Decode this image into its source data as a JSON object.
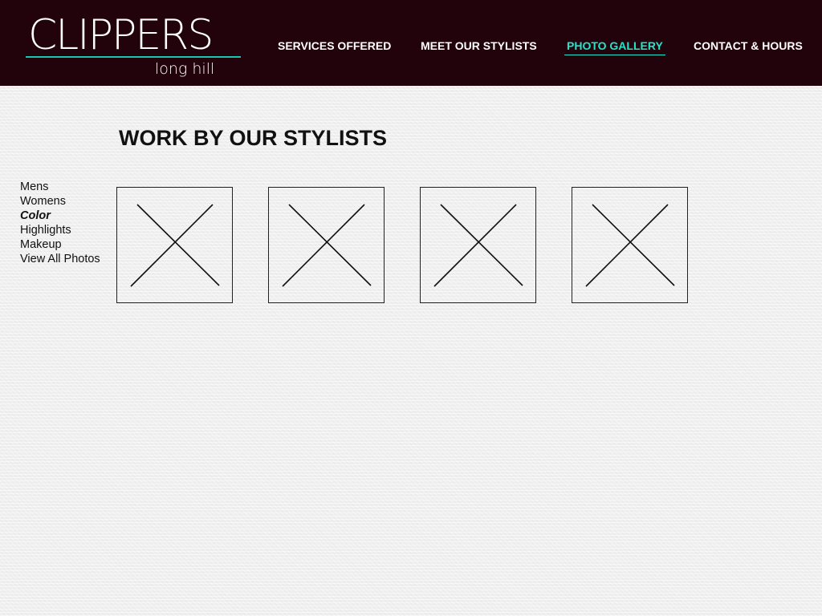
{
  "brand": {
    "name": "CLIPPERS",
    "location": "long hill",
    "accent_color": "#24e4cc",
    "header_color": "#23030b"
  },
  "nav": {
    "items": [
      {
        "label": "SERVICES OFFERED",
        "active": false
      },
      {
        "label": "MEET OUR STYLISTS",
        "active": false
      },
      {
        "label": "PHOTO GALLERY",
        "active": true
      },
      {
        "label": "CONTACT & HOURS",
        "active": false
      }
    ]
  },
  "page": {
    "title": "WORK BY OUR STYLISTS"
  },
  "gallery_nav": {
    "items": [
      {
        "label": "Mens",
        "active": false
      },
      {
        "label": "Womens",
        "active": false
      },
      {
        "label": "Color",
        "active": true
      },
      {
        "label": "Highlights",
        "active": false
      },
      {
        "label": "Makeup",
        "active": false
      },
      {
        "label": "View All Photos",
        "active": false
      }
    ]
  },
  "gallery": {
    "photos": [
      {
        "placeholder_icon": "image-placeholder-icon"
      },
      {
        "placeholder_icon": "image-placeholder-icon"
      },
      {
        "placeholder_icon": "image-placeholder-icon"
      },
      {
        "placeholder_icon": "image-placeholder-icon"
      }
    ]
  }
}
